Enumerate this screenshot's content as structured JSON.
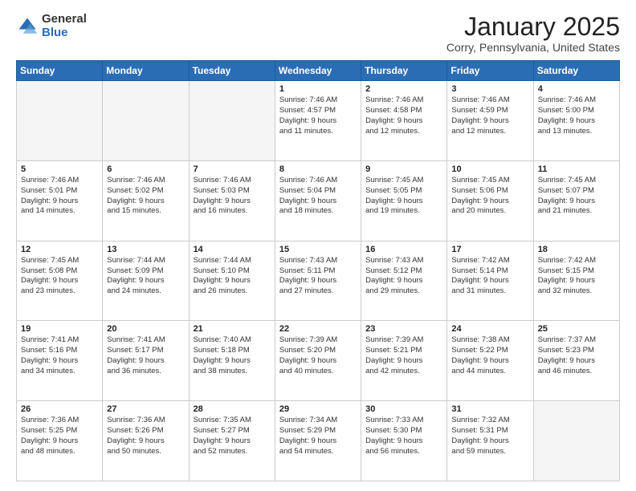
{
  "logo": {
    "general": "General",
    "blue": "Blue"
  },
  "title": "January 2025",
  "location": "Corry, Pennsylvania, United States",
  "days_header": [
    "Sunday",
    "Monday",
    "Tuesday",
    "Wednesday",
    "Thursday",
    "Friday",
    "Saturday"
  ],
  "weeks": [
    [
      {
        "day": "",
        "info": ""
      },
      {
        "day": "",
        "info": ""
      },
      {
        "day": "",
        "info": ""
      },
      {
        "day": "1",
        "info": "Sunrise: 7:46 AM\nSunset: 4:57 PM\nDaylight: 9 hours\nand 11 minutes."
      },
      {
        "day": "2",
        "info": "Sunrise: 7:46 AM\nSunset: 4:58 PM\nDaylight: 9 hours\nand 12 minutes."
      },
      {
        "day": "3",
        "info": "Sunrise: 7:46 AM\nSunset: 4:59 PM\nDaylight: 9 hours\nand 12 minutes."
      },
      {
        "day": "4",
        "info": "Sunrise: 7:46 AM\nSunset: 5:00 PM\nDaylight: 9 hours\nand 13 minutes."
      }
    ],
    [
      {
        "day": "5",
        "info": "Sunrise: 7:46 AM\nSunset: 5:01 PM\nDaylight: 9 hours\nand 14 minutes."
      },
      {
        "day": "6",
        "info": "Sunrise: 7:46 AM\nSunset: 5:02 PM\nDaylight: 9 hours\nand 15 minutes."
      },
      {
        "day": "7",
        "info": "Sunrise: 7:46 AM\nSunset: 5:03 PM\nDaylight: 9 hours\nand 16 minutes."
      },
      {
        "day": "8",
        "info": "Sunrise: 7:46 AM\nSunset: 5:04 PM\nDaylight: 9 hours\nand 18 minutes."
      },
      {
        "day": "9",
        "info": "Sunrise: 7:45 AM\nSunset: 5:05 PM\nDaylight: 9 hours\nand 19 minutes."
      },
      {
        "day": "10",
        "info": "Sunrise: 7:45 AM\nSunset: 5:06 PM\nDaylight: 9 hours\nand 20 minutes."
      },
      {
        "day": "11",
        "info": "Sunrise: 7:45 AM\nSunset: 5:07 PM\nDaylight: 9 hours\nand 21 minutes."
      }
    ],
    [
      {
        "day": "12",
        "info": "Sunrise: 7:45 AM\nSunset: 5:08 PM\nDaylight: 9 hours\nand 23 minutes."
      },
      {
        "day": "13",
        "info": "Sunrise: 7:44 AM\nSunset: 5:09 PM\nDaylight: 9 hours\nand 24 minutes."
      },
      {
        "day": "14",
        "info": "Sunrise: 7:44 AM\nSunset: 5:10 PM\nDaylight: 9 hours\nand 26 minutes."
      },
      {
        "day": "15",
        "info": "Sunrise: 7:43 AM\nSunset: 5:11 PM\nDaylight: 9 hours\nand 27 minutes."
      },
      {
        "day": "16",
        "info": "Sunrise: 7:43 AM\nSunset: 5:12 PM\nDaylight: 9 hours\nand 29 minutes."
      },
      {
        "day": "17",
        "info": "Sunrise: 7:42 AM\nSunset: 5:14 PM\nDaylight: 9 hours\nand 31 minutes."
      },
      {
        "day": "18",
        "info": "Sunrise: 7:42 AM\nSunset: 5:15 PM\nDaylight: 9 hours\nand 32 minutes."
      }
    ],
    [
      {
        "day": "19",
        "info": "Sunrise: 7:41 AM\nSunset: 5:16 PM\nDaylight: 9 hours\nand 34 minutes."
      },
      {
        "day": "20",
        "info": "Sunrise: 7:41 AM\nSunset: 5:17 PM\nDaylight: 9 hours\nand 36 minutes."
      },
      {
        "day": "21",
        "info": "Sunrise: 7:40 AM\nSunset: 5:18 PM\nDaylight: 9 hours\nand 38 minutes."
      },
      {
        "day": "22",
        "info": "Sunrise: 7:39 AM\nSunset: 5:20 PM\nDaylight: 9 hours\nand 40 minutes."
      },
      {
        "day": "23",
        "info": "Sunrise: 7:39 AM\nSunset: 5:21 PM\nDaylight: 9 hours\nand 42 minutes."
      },
      {
        "day": "24",
        "info": "Sunrise: 7:38 AM\nSunset: 5:22 PM\nDaylight: 9 hours\nand 44 minutes."
      },
      {
        "day": "25",
        "info": "Sunrise: 7:37 AM\nSunset: 5:23 PM\nDaylight: 9 hours\nand 46 minutes."
      }
    ],
    [
      {
        "day": "26",
        "info": "Sunrise: 7:36 AM\nSunset: 5:25 PM\nDaylight: 9 hours\nand 48 minutes."
      },
      {
        "day": "27",
        "info": "Sunrise: 7:36 AM\nSunset: 5:26 PM\nDaylight: 9 hours\nand 50 minutes."
      },
      {
        "day": "28",
        "info": "Sunrise: 7:35 AM\nSunset: 5:27 PM\nDaylight: 9 hours\nand 52 minutes."
      },
      {
        "day": "29",
        "info": "Sunrise: 7:34 AM\nSunset: 5:29 PM\nDaylight: 9 hours\nand 54 minutes."
      },
      {
        "day": "30",
        "info": "Sunrise: 7:33 AM\nSunset: 5:30 PM\nDaylight: 9 hours\nand 56 minutes."
      },
      {
        "day": "31",
        "info": "Sunrise: 7:32 AM\nSunset: 5:31 PM\nDaylight: 9 hours\nand 59 minutes."
      },
      {
        "day": "",
        "info": ""
      }
    ]
  ]
}
